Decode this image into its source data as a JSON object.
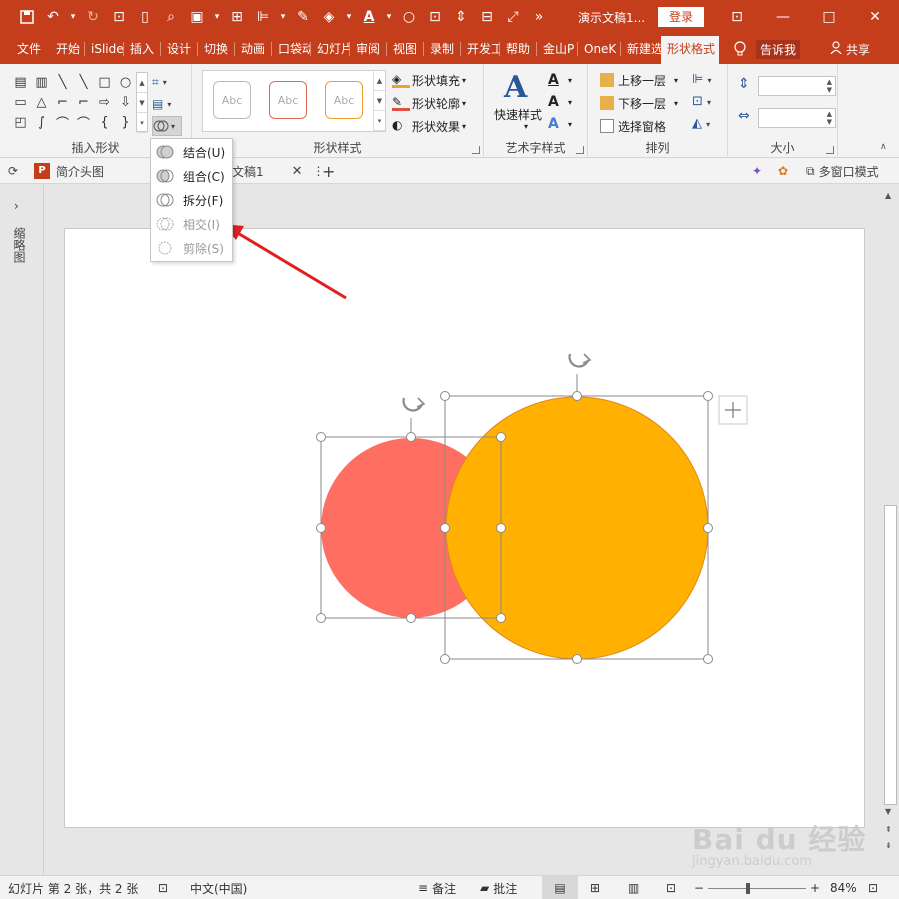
{
  "app": {
    "doc_title": "演示文稿1...",
    "login": "登录"
  },
  "tabs": [
    "文件",
    "开始",
    "iSlide",
    "插入",
    "设计",
    "切换",
    "动画",
    "口袋动",
    "幻灯片",
    "审阅",
    "视图",
    "录制",
    "开发工",
    "帮助",
    "金山P",
    "OneK",
    "新建选",
    "形状格式"
  ],
  "tabs_right": {
    "tell_me": "告诉我",
    "share": "共享"
  },
  "ribbon": {
    "insert_shapes_label": "插入形状",
    "shape_styles_label": "形状样式",
    "art_styles_label": "艺术字样式",
    "arrange_label": "排列",
    "size_label": "大小",
    "abc": [
      "Abc",
      "Abc",
      "Abc"
    ],
    "fill": "形状填充",
    "outline": "形状轮廓",
    "effect": "形状效果",
    "quick_styles": "快速样式",
    "bring_forward": "上移一层",
    "send_backward": "下移一层",
    "selection_pane": "选择窗格"
  },
  "docbar": {
    "intro": "简介头图",
    "tab_name": "文稿1",
    "multi_window": "多窗口模式"
  },
  "menu": {
    "items": [
      {
        "label": "结合(U)"
      },
      {
        "label": "组合(C)"
      },
      {
        "label": "拆分(F)"
      },
      {
        "label": "相交(I)"
      },
      {
        "label": "剪除(S)"
      }
    ]
  },
  "left_panel": {
    "label": "缩略图"
  },
  "statusbar": {
    "slide_info": "幻灯片 第 2 张，共 2 张",
    "language": "中文(中国)",
    "notes": "备注",
    "comments": "批注",
    "zoom": "84%"
  },
  "watermark": {
    "big": "Bai du 经验",
    "small": "jingyan.baidu.com"
  },
  "colors": {
    "accent": "#c43e1c",
    "circle_left": "#ff6f61",
    "circle_right": "#ffb000",
    "arrow": "#e02020"
  }
}
